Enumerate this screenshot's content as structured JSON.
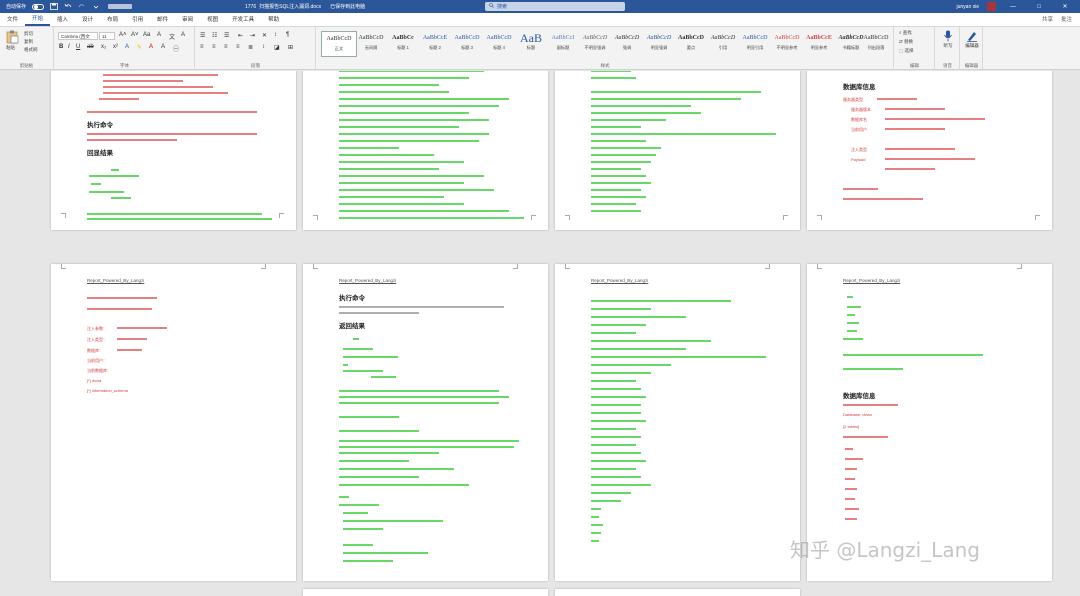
{
  "titlebar": {
    "autosave_label": "自动保存",
    "autosave_state": "关",
    "doc_number": "1776",
    "doc_name": "扫描报告SQL注入漏洞.docx",
    "saved_status": "已保存到此电脑",
    "search_placeholder": "搜索",
    "user_name": "junyan xie",
    "minimize": "—",
    "maximize": "□",
    "close": "✕"
  },
  "menu": {
    "tabs": [
      "文件",
      "开始",
      "插入",
      "设计",
      "布局",
      "引用",
      "邮件",
      "审阅",
      "视图",
      "开发工具",
      "帮助"
    ],
    "active_index": 1,
    "share": "共享",
    "comments": "批注"
  },
  "ribbon": {
    "clipboard": {
      "paste": "粘贴",
      "cut": "剪切",
      "copy": "复制",
      "format_painter": "格式刷",
      "label": "剪贴板"
    },
    "font": {
      "family": "Cambria (西文",
      "size": "11",
      "label": "字体"
    },
    "paragraph": {
      "label": "段落"
    },
    "styles": {
      "label": "样式",
      "items": [
        {
          "preview": "AaBbCcD",
          "name": "正文"
        },
        {
          "preview": "AaBbCcD",
          "name": "无间隔"
        },
        {
          "preview": "AaBbCc",
          "name": "标题 1"
        },
        {
          "preview": "AaBbCcE",
          "name": "标题 2"
        },
        {
          "preview": "AaBbCcD",
          "name": "标题 3"
        },
        {
          "preview": "AaBbCcD",
          "name": "标题 4"
        },
        {
          "preview": "AaB",
          "name": "标题"
        },
        {
          "preview": "AaBbCcI",
          "name": "副标题"
        },
        {
          "preview": "AaBbCcD",
          "name": "不明显强调"
        },
        {
          "preview": "AaBbCcD",
          "name": "强调"
        },
        {
          "preview": "AaBbCcD",
          "name": "明显强调"
        },
        {
          "preview": "AaBbCcD",
          "name": "要点"
        },
        {
          "preview": "AaBbCcD",
          "name": "引用"
        },
        {
          "preview": "AaBbCcD",
          "name": "明显引用"
        },
        {
          "preview": "AaBbCcD",
          "name": "不明显参考"
        },
        {
          "preview": "AaBbCcE",
          "name": "明显参考"
        },
        {
          "preview": "AaBbCcD",
          "name": "书籍标题"
        },
        {
          "preview": "AaBbCcD",
          "name": "列出段落"
        }
      ]
    },
    "editing": {
      "find": "查找",
      "replace": "替换",
      "select": "选择",
      "label": "编辑"
    },
    "voice": {
      "dictate": "听写",
      "label": "语音"
    },
    "editor": {
      "button": "编辑器",
      "label": "编辑器"
    }
  },
  "pages": {
    "header_text": "Report_Powered_By_Langzi",
    "p1_cmd_title": "执行命令",
    "p1_result_title": "回显结果",
    "p4_data_title": "数据库信息",
    "p4_items": [
      "服务器类型",
      "服务器版本",
      "数据库名",
      "当前用户",
      "注入类型",
      "Payload"
    ],
    "p5_items": [
      "注入参数：",
      "注入类型：",
      "数据库：",
      "当前用户：",
      "当前数据库：",
      "[*] dvwa",
      "[*] information_schema"
    ],
    "p6_cmd_title": "执行命令",
    "p6_result_title": "返回结果",
    "p8_data_title": "数据库信息",
    "p8_db_label": "Database: dvwa",
    "p8_tables_label": "[2 tables]"
  },
  "watermark": "知乎 @Langzi_Lang"
}
